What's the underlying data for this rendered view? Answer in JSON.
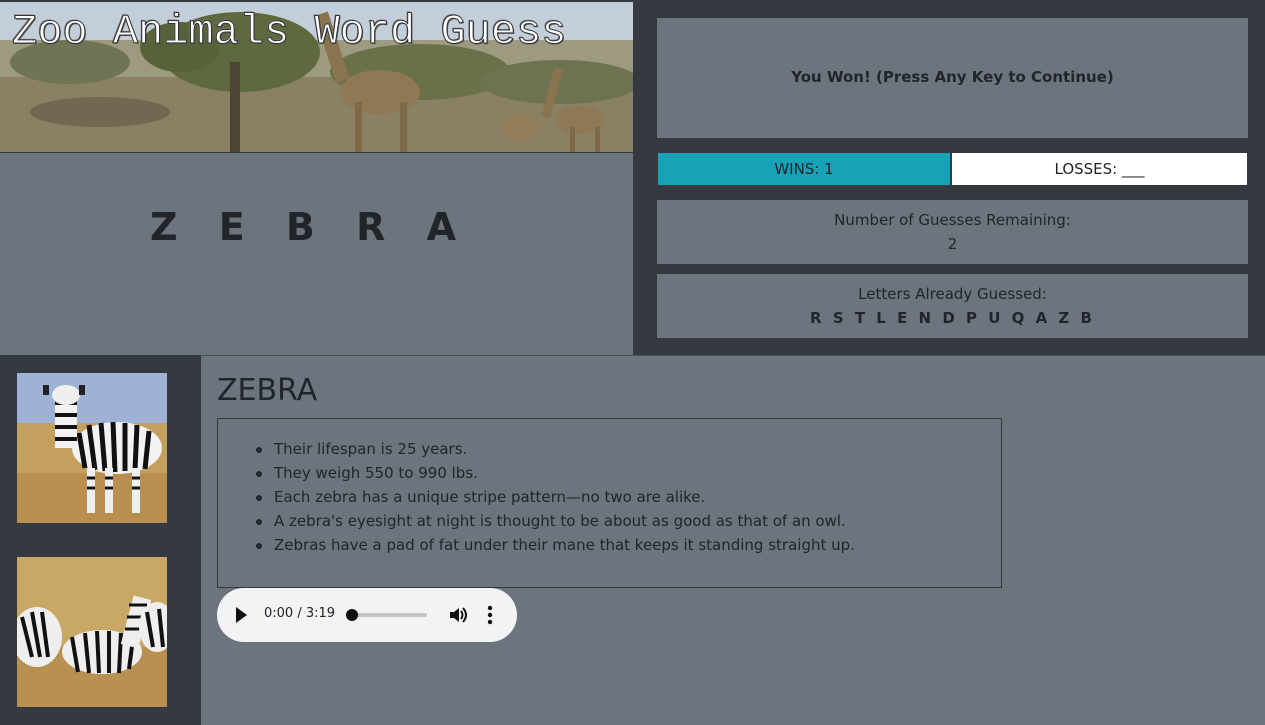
{
  "header": {
    "title": "Zoo Animals Word Guess"
  },
  "game": {
    "current_word": "Z E B R A",
    "status_message": "You Won! (Press Any Key to Continue)",
    "wins_label": "WINS: 1",
    "losses_label": "LOSSES: ___",
    "guesses_label": "Number of Guesses Remaining:",
    "guesses_remaining": "2",
    "letters_label": "Letters Already Guessed:",
    "letters_guessed": "R S T L E N D P U Q A Z B"
  },
  "animal_info": {
    "name": "ZEBRA",
    "facts": [
      "Their lifespan is 25 years.",
      "They weigh 550 to 990 lbs.",
      "Each zebra has a unique stripe pattern—no two are alike.",
      "A zebra's eyesight at night is thought to be about as good as that of an owl.",
      "Zebras have a pad of fat under their mane that keeps it standing straight up."
    ]
  },
  "audio_player": {
    "time_display": "0:00 / 3:19",
    "progress": 0
  },
  "colors": {
    "background": "#343a40",
    "panel": "#6c757d",
    "wins_accent": "#17a2b8",
    "losses_bg": "#ffffff"
  }
}
